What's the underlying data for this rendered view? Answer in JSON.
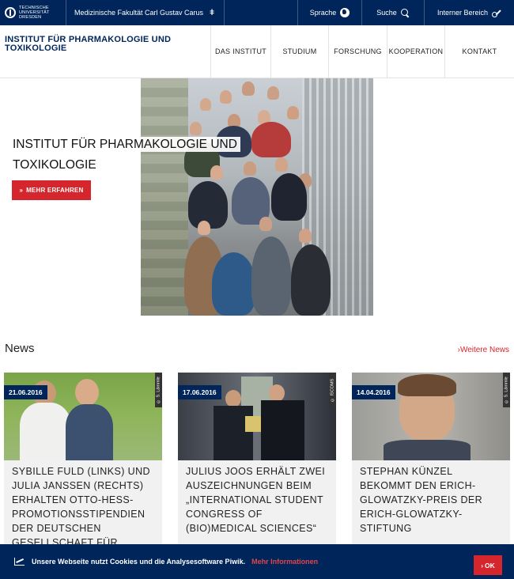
{
  "topbar": {
    "logo_text": [
      "TECHNISCHE",
      "UNIVERSITÄT",
      "DRESDEN"
    ],
    "faculty": "Medizinische Fakultät Carl Gustav Carus",
    "faculty_caret": "ǂ",
    "language": "Sprache",
    "search": "Suche",
    "internal": "Interner Bereich"
  },
  "header": {
    "institute": "INSTITUT FÜR PHARMAKOLOGIE UND TOXIKOLOGIE",
    "nav": [
      "DAS INSTITUT",
      "STUDIUM",
      "FORSCHUNG",
      "KOOPERATION",
      "KONTAKT"
    ]
  },
  "hero": {
    "title": "INSTITUT FÜR PHARMAKOLOGIE UND TOXIKOLOGIE",
    "button_label": "MEHR ERFAHREN",
    "button_icon": "chevron-double-down-icon"
  },
  "news": {
    "title": "News",
    "more": "›Weitere News",
    "items": [
      {
        "date": "21.06.2016",
        "credit": "© S. Lämmle",
        "headline": "SYBILLE FULD (LINKS) UND JULIA JANSSEN (RECHTS) ERHALTEN OTTO-HESS-PROMOTIONSSTIPENDIEN DER DEUTSCHEN GESELLSCHAFT FÜR"
      },
      {
        "date": "17.06.2016",
        "credit": "© ISCOMS",
        "headline": "JULIUS JOOS ERHÄLT ZWEI AUSZEICHNUNGEN BEIM „INTERNATIONAL STUDENT CONGRESS OF (BIO)MEDICAL SCIENCES“"
      },
      {
        "date": "14.04.2016",
        "credit": "© S. Lämmle",
        "headline": "STEPHAN KÜNZEL BEKOMMT DEN ERICH-GLOWATZKY-PREIS DER ERICH-GLOWATZKY-STIFTUNG"
      }
    ]
  },
  "cookie": {
    "message": "Unsere Webseite nutzt Cookies und die Analysesoftware Piwik.",
    "link": "Mehr Informationen",
    "ok": "OK"
  },
  "colors": {
    "navy": "#00255a",
    "red": "#d4262c"
  }
}
